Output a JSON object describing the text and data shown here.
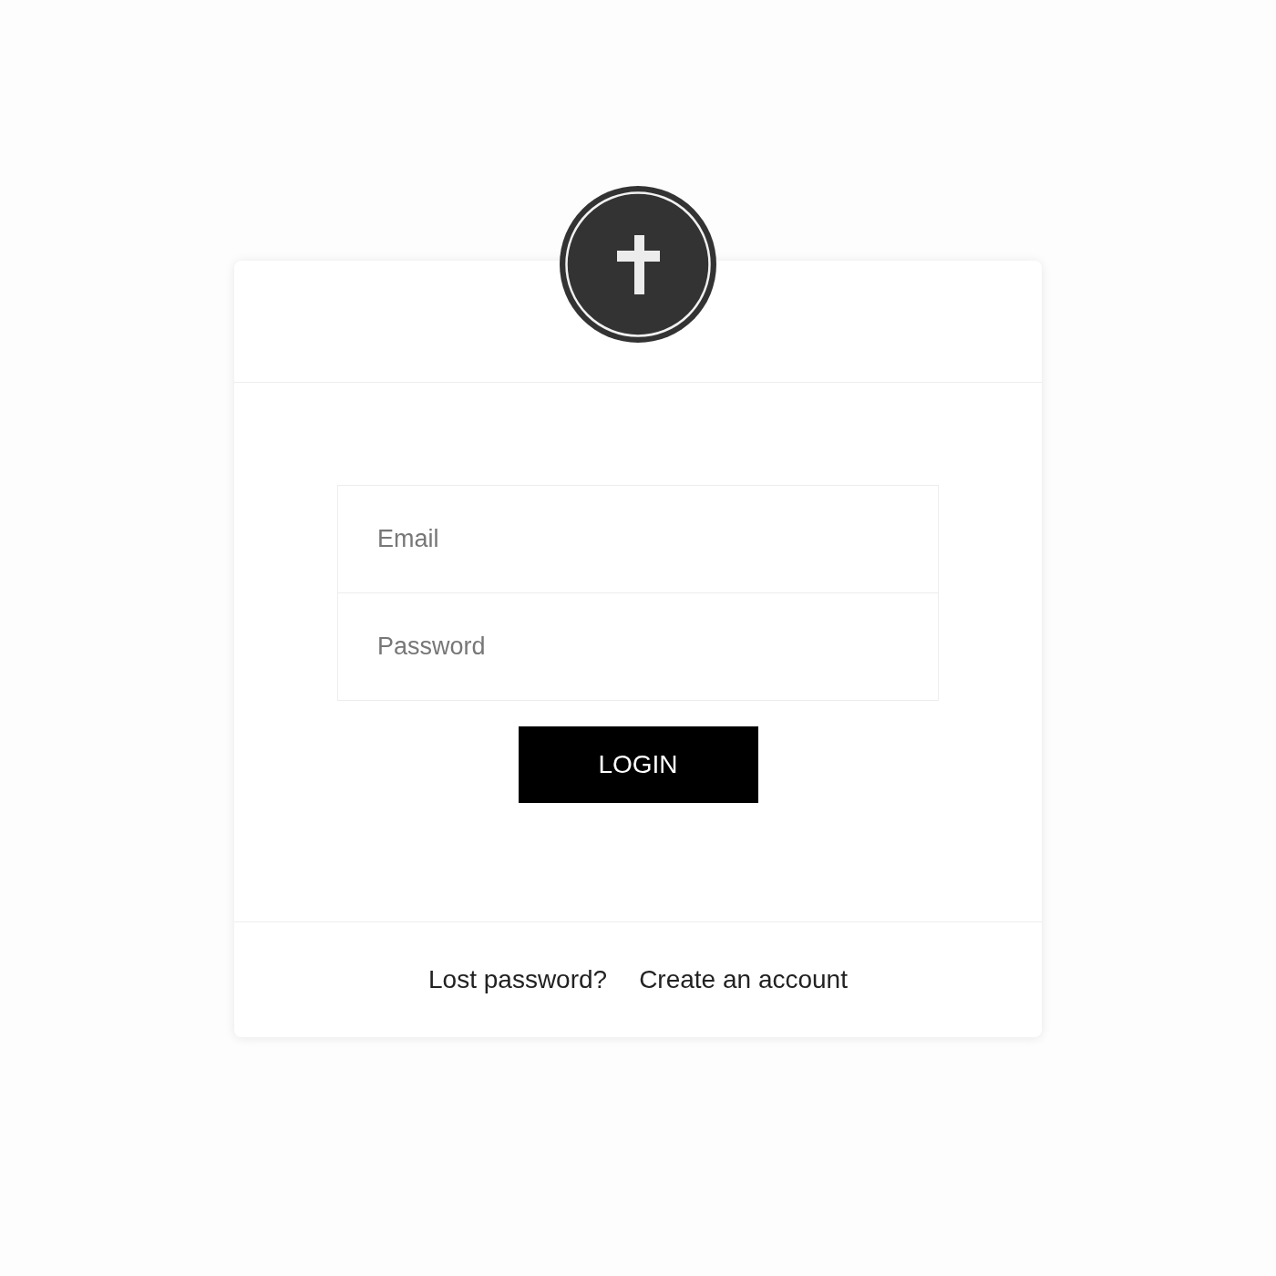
{
  "form": {
    "fields": [
      {
        "placeholder": "Email"
      },
      {
        "placeholder": "Password"
      }
    ],
    "submit_button": "LOGIN"
  },
  "footer_links": [
    "Lost password?",
    "Create an account"
  ]
}
